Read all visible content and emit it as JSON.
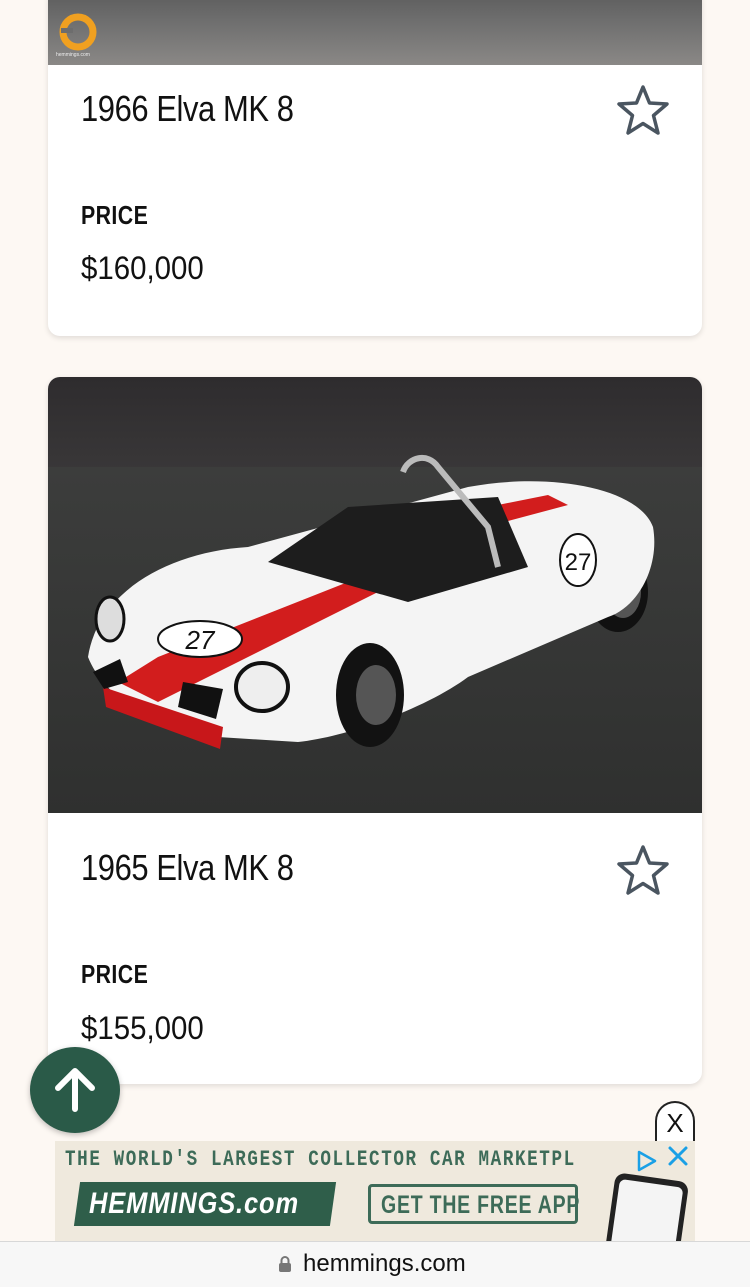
{
  "listings": [
    {
      "title": "1966 Elva MK 8",
      "price_label": "PRICE",
      "price": "$160,000",
      "photo_badge": "hemmings.com"
    },
    {
      "title": "1965 Elva MK 8",
      "price_label": "PRICE",
      "price": "$155,000",
      "car_number": "27"
    }
  ],
  "ad": {
    "close_label": "X",
    "headline": "THE WORLD'S LARGEST COLLECTOR CAR MARKETPL",
    "brand": "HEMMINGS.com",
    "cta": "GET THE FREE APP"
  },
  "browser": {
    "url": "hemmings.com"
  },
  "colors": {
    "page_bg": "#fdf8f3",
    "brand_green": "#2a5a48",
    "ad_green": "#3d6b58",
    "star_outline": "#4a5560"
  },
  "icons": {
    "favorite": "star-outline-icon",
    "scroll_top": "arrow-up-icon",
    "lock": "lock-icon",
    "ad_choices": "ad-choices-icon"
  }
}
